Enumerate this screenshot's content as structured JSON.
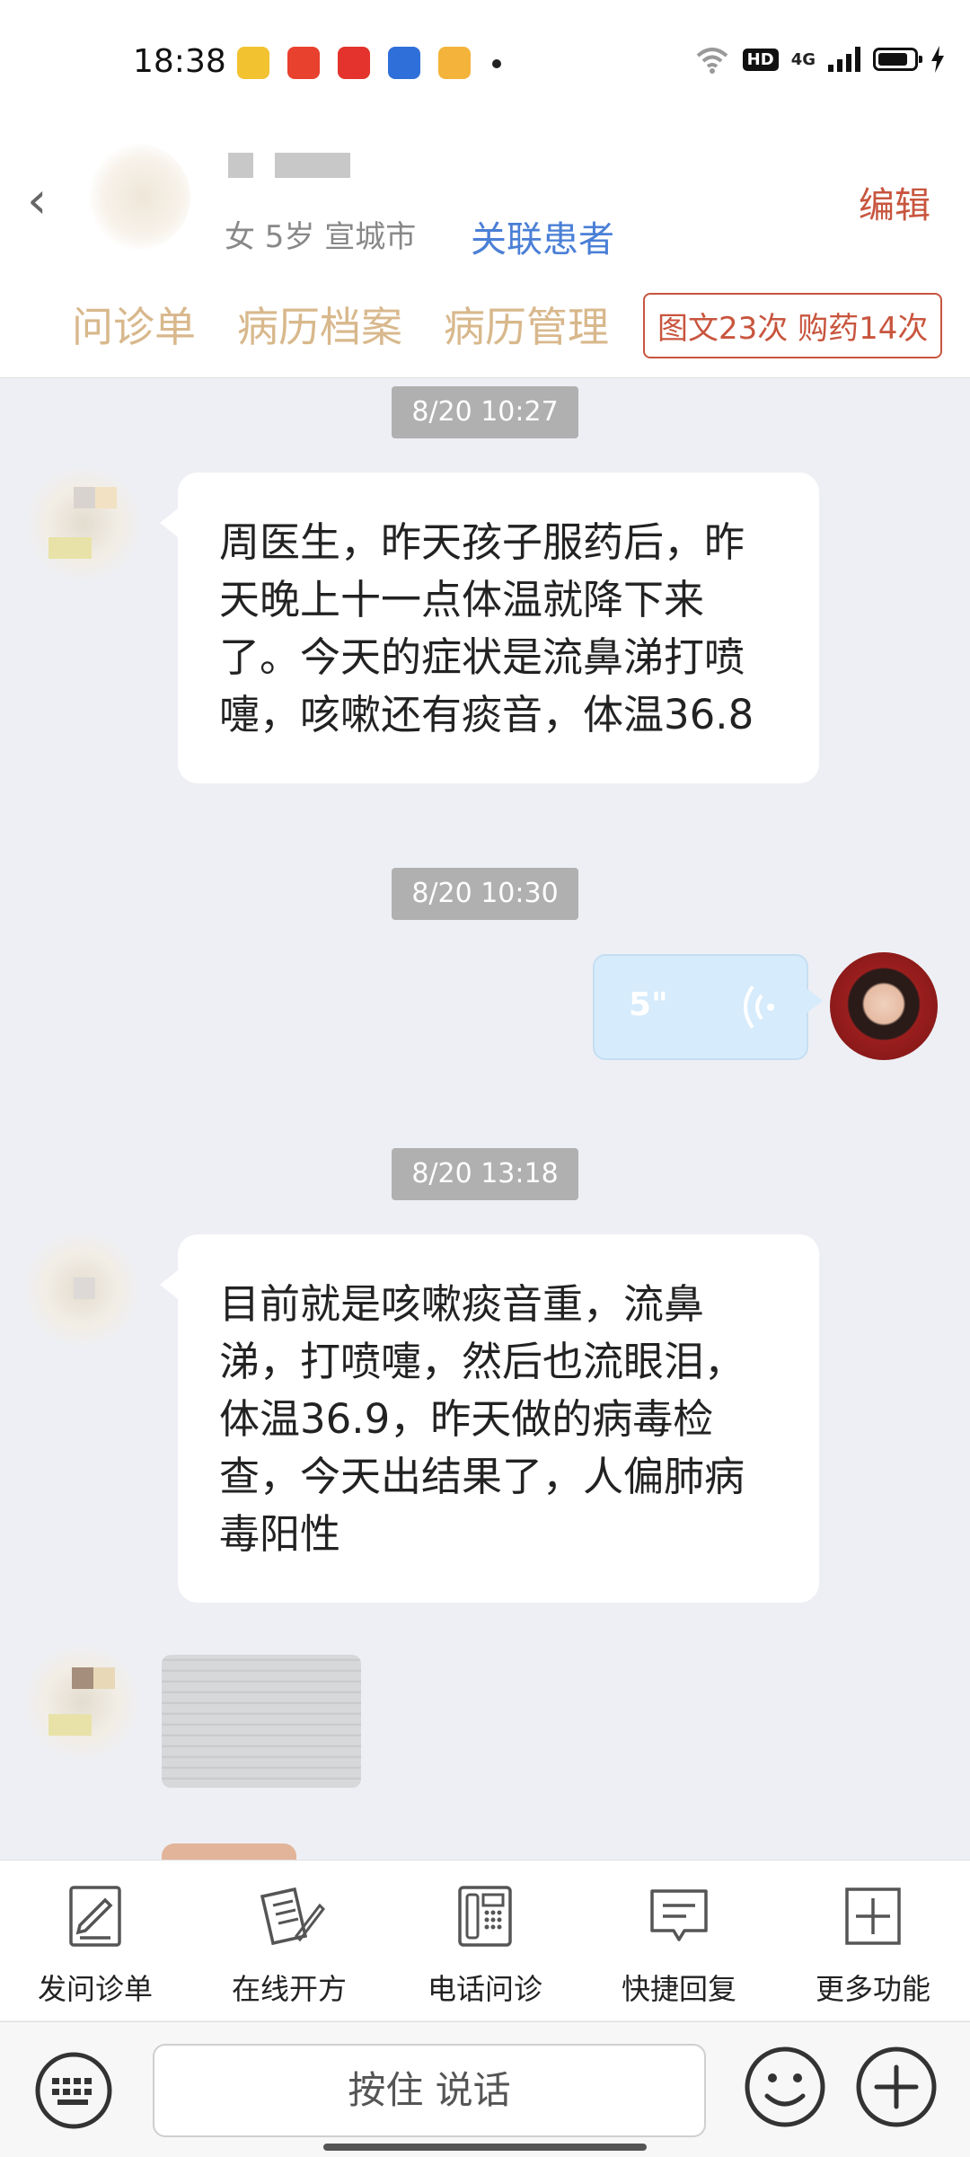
{
  "status_bar": {
    "time": "18:38",
    "apps": [
      "#f2c230",
      "#e8412e",
      "#e3332c",
      "#2f6fd9",
      "#f4b33a"
    ],
    "hd": "HD",
    "network": "4G",
    "battery_level": 0.85
  },
  "header": {
    "patient_info": "女 5岁  宣城市",
    "link_patient": "关联患者",
    "edit": "编辑",
    "tabs": [
      "问诊单",
      "病历档案",
      "病历管理"
    ],
    "badge": "图文23次 购药14次"
  },
  "chat": {
    "messages": [
      {
        "time": "8/20 10:27",
        "text": "周医生，昨天孩子服药后，昨天晚上十一点体温就降下来了。今天的症状是流鼻涕打喷嚏，咳嗽还有痰音，体温36.8"
      },
      {
        "time": "8/20 10:30",
        "voice_duration": "5\""
      },
      {
        "time": "8/20 13:18",
        "text": "目前就是咳嗽痰音重，流鼻涕，打喷嚏，然后也流眼泪，体温36.9，昨天做的病毒检查，今天出结果了，人偏肺病毒阳性"
      }
    ]
  },
  "toolbar": {
    "items": [
      "发问诊单",
      "在线开方",
      "电话问诊",
      "快捷回复",
      "更多功能"
    ]
  },
  "input": {
    "hold_to_talk": "按住 说话"
  }
}
